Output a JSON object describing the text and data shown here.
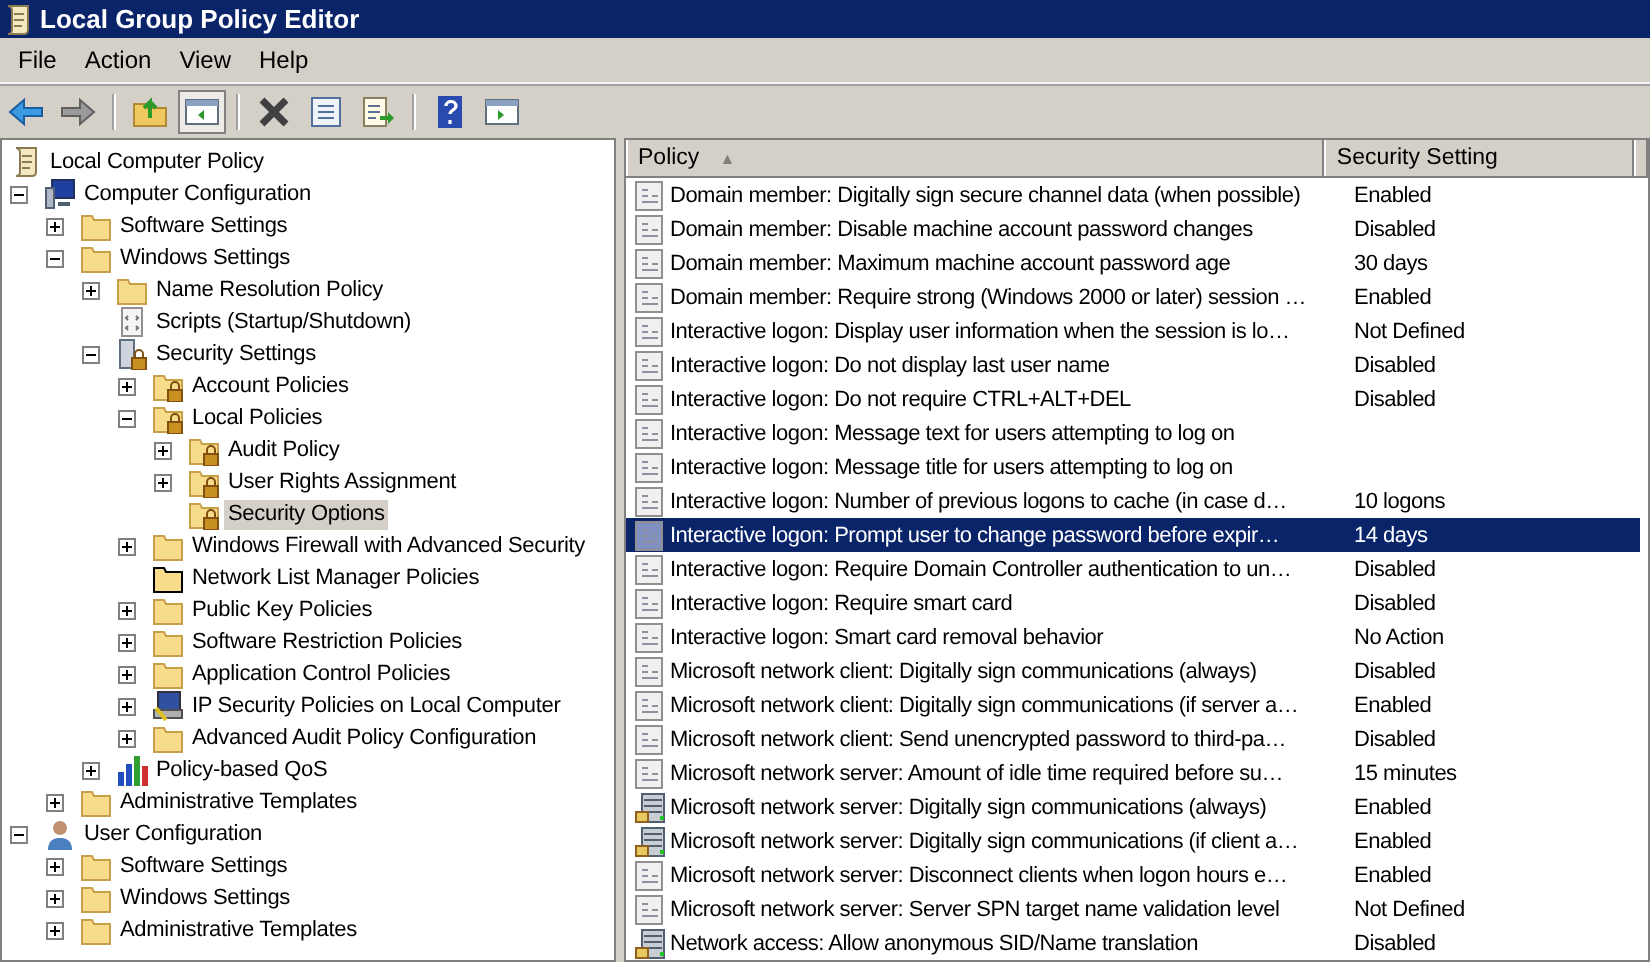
{
  "window": {
    "title": "Local Group Policy Editor"
  },
  "menu": [
    "File",
    "Action",
    "View",
    "Help"
  ],
  "toolbar": [
    {
      "kind": "back",
      "pressed": false
    },
    {
      "kind": "forward",
      "pressed": false
    },
    {
      "kind": "sep"
    },
    {
      "kind": "up",
      "pressed": false
    },
    {
      "kind": "tree",
      "pressed": true
    },
    {
      "kind": "sep"
    },
    {
      "kind": "delete",
      "pressed": false
    },
    {
      "kind": "properties",
      "pressed": false
    },
    {
      "kind": "export",
      "pressed": false
    },
    {
      "kind": "sep"
    },
    {
      "kind": "help",
      "pressed": false
    },
    {
      "kind": "action",
      "pressed": false
    }
  ],
  "tree": [
    {
      "label": "Local Computer Policy",
      "kind": "policy",
      "selected": false,
      "children": [
        {
          "label": "Computer Configuration",
          "kind": "computer",
          "expanded": true,
          "selected": false,
          "children": [
            {
              "label": "Software Settings",
              "kind": "folder",
              "expanded": false,
              "selected": false
            },
            {
              "label": "Windows Settings",
              "kind": "folder",
              "expanded": true,
              "selected": false,
              "children": [
                {
                  "label": "Name Resolution Policy",
                  "kind": "folder",
                  "expanded": false,
                  "selected": false
                },
                {
                  "label": "Scripts (Startup/Shutdown)",
                  "kind": "script",
                  "selected": false
                },
                {
                  "label": "Security Settings",
                  "kind": "security",
                  "expanded": true,
                  "selected": false,
                  "children": [
                    {
                      "label": "Account Policies",
                      "kind": "lockfolder",
                      "expanded": false,
                      "selected": false
                    },
                    {
                      "label": "Local Policies",
                      "kind": "lockfolder",
                      "expanded": true,
                      "selected": false,
                      "children": [
                        {
                          "label": "Audit Policy",
                          "kind": "lockfolder",
                          "expanded": false,
                          "selected": false
                        },
                        {
                          "label": "User Rights Assignment",
                          "kind": "lockfolder",
                          "expanded": false,
                          "selected": false
                        },
                        {
                          "label": "Security Options",
                          "kind": "lockfolder",
                          "selected": true
                        }
                      ]
                    },
                    {
                      "label": "Windows Firewall with Advanced Security",
                      "kind": "folder",
                      "expanded": false,
                      "selected": false
                    },
                    {
                      "label": "Network List Manager Policies",
                      "kind": "netfolder",
                      "selected": false
                    },
                    {
                      "label": "Public Key Policies",
                      "kind": "folder",
                      "expanded": false,
                      "selected": false
                    },
                    {
                      "label": "Software Restriction Policies",
                      "kind": "folder",
                      "expanded": false,
                      "selected": false
                    },
                    {
                      "label": "Application Control Policies",
                      "kind": "folder",
                      "expanded": false,
                      "selected": false
                    },
                    {
                      "label": "IP Security Policies on Local Computer",
                      "kind": "ipsec",
                      "expanded": false,
                      "selected": false
                    },
                    {
                      "label": "Advanced Audit Policy Configuration",
                      "kind": "folder",
                      "expanded": false,
                      "selected": false
                    }
                  ]
                },
                {
                  "label": "Policy-based QoS",
                  "kind": "qos",
                  "expanded": false,
                  "selected": false
                }
              ]
            },
            {
              "label": "Administrative Templates",
              "kind": "folder",
              "expanded": false,
              "selected": false
            }
          ]
        },
        {
          "label": "User Configuration",
          "kind": "user",
          "expanded": true,
          "selected": false,
          "children": [
            {
              "label": "Software Settings",
              "kind": "folder",
              "expanded": false,
              "selected": false
            },
            {
              "label": "Windows Settings",
              "kind": "folder",
              "expanded": false,
              "selected": false
            },
            {
              "label": "Administrative Templates",
              "kind": "folder",
              "expanded": false,
              "selected": false
            }
          ]
        }
      ]
    }
  ],
  "table": {
    "columns": [
      {
        "label": "Policy",
        "sort_icon": "▲"
      },
      {
        "label": "Security Setting"
      }
    ],
    "rows": [
      {
        "policy": "Domain member: Digitally sign secure channel data (when possible)",
        "setting": "Enabled",
        "kind": "policy",
        "selected": false
      },
      {
        "policy": "Domain member: Disable machine account password changes",
        "setting": "Disabled",
        "kind": "policy",
        "selected": false
      },
      {
        "policy": "Domain member: Maximum machine account password age",
        "setting": "30 days",
        "kind": "policy",
        "selected": false
      },
      {
        "policy": "Domain member: Require strong (Windows 2000 or later) session …",
        "setting": "Enabled",
        "kind": "policy",
        "selected": false
      },
      {
        "policy": "Interactive logon: Display user information when the session is lo…",
        "setting": "Not Defined",
        "kind": "policy",
        "selected": false
      },
      {
        "policy": "Interactive logon: Do not display last user name",
        "setting": "Disabled",
        "kind": "policy",
        "selected": false
      },
      {
        "policy": "Interactive logon: Do not require CTRL+ALT+DEL",
        "setting": "Disabled",
        "kind": "policy",
        "selected": false
      },
      {
        "policy": "Interactive logon: Message text for users attempting to log on",
        "kind": "policy",
        "selected": false
      },
      {
        "policy": "Interactive logon: Message title for users attempting to log on",
        "kind": "policy",
        "selected": false
      },
      {
        "policy": "Interactive logon: Number of previous logons to cache (in case d…",
        "setting": "10 logons",
        "kind": "policy",
        "selected": false
      },
      {
        "policy": "Interactive logon: Prompt user to change password before expir…",
        "setting": "14 days",
        "kind": "policy",
        "selected": true
      },
      {
        "policy": "Interactive logon: Require Domain Controller authentication to un…",
        "setting": "Disabled",
        "kind": "policy",
        "selected": false
      },
      {
        "policy": "Interactive logon: Require smart card",
        "setting": "Disabled",
        "kind": "policy",
        "selected": false
      },
      {
        "policy": "Interactive logon: Smart card removal behavior",
        "setting": "No Action",
        "kind": "policy",
        "selected": false
      },
      {
        "policy": "Microsoft network client: Digitally sign communications (always)",
        "setting": "Disabled",
        "kind": "policy",
        "selected": false
      },
      {
        "policy": "Microsoft network client: Digitally sign communications (if server a…",
        "setting": "Enabled",
        "kind": "policy",
        "selected": false
      },
      {
        "policy": "Microsoft network client: Send unencrypted password to third-pa…",
        "setting": "Disabled",
        "kind": "policy",
        "selected": false
      },
      {
        "policy": "Microsoft network server: Amount of idle time required before su…",
        "setting": "15 minutes",
        "kind": "policy",
        "selected": false
      },
      {
        "policy": "Microsoft network server: Digitally sign communications (always)",
        "setting": "Enabled",
        "kind": "server",
        "selected": false
      },
      {
        "policy": "Microsoft network server: Digitally sign communications (if client a…",
        "setting": "Enabled",
        "kind": "server",
        "selected": false
      },
      {
        "policy": "Microsoft network server: Disconnect clients when logon hours e…",
        "setting": "Enabled",
        "kind": "policy",
        "selected": false
      },
      {
        "policy": "Microsoft network server: Server SPN target name validation level",
        "setting": "Not Defined",
        "kind": "policy",
        "selected": false
      },
      {
        "policy": "Network access: Allow anonymous SID/Name translation",
        "setting": "Disabled",
        "kind": "server",
        "selected": false
      }
    ]
  }
}
